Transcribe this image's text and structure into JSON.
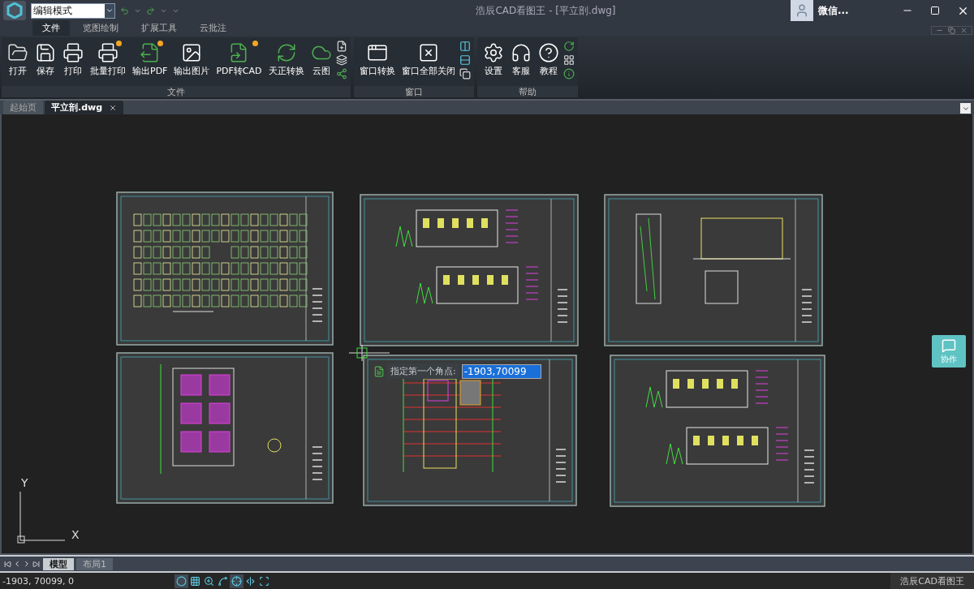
{
  "title_bar": {
    "mode_select": "编辑模式",
    "app_title": "浩辰CAD看图王 - [平立剖.dwg]",
    "user_name": "微信..."
  },
  "ribbon_tabs": [
    {
      "label": "文件",
      "selected": true
    },
    {
      "label": "览图绘制",
      "selected": false
    },
    {
      "label": "扩展工具",
      "selected": false
    },
    {
      "label": "云批注",
      "selected": false
    }
  ],
  "ribbon_groups": [
    {
      "title": "文件",
      "buttons": [
        {
          "label": "打开",
          "premium": false
        },
        {
          "label": "保存",
          "premium": false
        },
        {
          "label": "打印",
          "premium": false
        },
        {
          "label": "批量打印",
          "premium": true
        },
        {
          "label": "输出PDF",
          "premium": true
        },
        {
          "label": "输出图片",
          "premium": false
        },
        {
          "label": "PDF转CAD",
          "premium": true
        },
        {
          "label": "天正转换",
          "premium": false
        },
        {
          "label": "云图",
          "premium": false
        }
      ]
    },
    {
      "title": "窗口",
      "buttons": [
        {
          "label": "窗口转换",
          "premium": false
        },
        {
          "label": "窗口全部关闭",
          "premium": false
        }
      ]
    },
    {
      "title": "帮助",
      "buttons": [
        {
          "label": "设置",
          "premium": false
        },
        {
          "label": "客服",
          "premium": false
        },
        {
          "label": "教程",
          "premium": false
        }
      ]
    }
  ],
  "doc_tabs": [
    {
      "label": "起始页",
      "selected": false
    },
    {
      "label": "平立剖.dwg",
      "selected": true
    }
  ],
  "canvas": {
    "sheets": [
      {
        "kind": "site-plan"
      },
      {
        "kind": "elevations"
      },
      {
        "kind": "sections"
      },
      {
        "kind": "floor-plan"
      },
      {
        "kind": "grid-plan"
      },
      {
        "kind": "elevations"
      }
    ],
    "prompt": {
      "label": "指定第一个角点:",
      "value": "-1903,70099"
    },
    "ucs": {
      "x_label": "X",
      "y_label": "Y"
    },
    "collab_button": "协作"
  },
  "layout_tabs": [
    {
      "label": "模型",
      "selected": true
    },
    {
      "label": "布局1",
      "selected": false
    }
  ],
  "status_bar": {
    "coords": "-1903, 70099, 0",
    "tools": [
      {
        "on": true
      },
      {
        "on": false
      },
      {
        "on": false
      },
      {
        "on": false
      },
      {
        "on": true
      },
      {
        "on": false
      },
      {
        "on": false
      }
    ],
    "app_name": "浩辰CAD看图王"
  }
}
